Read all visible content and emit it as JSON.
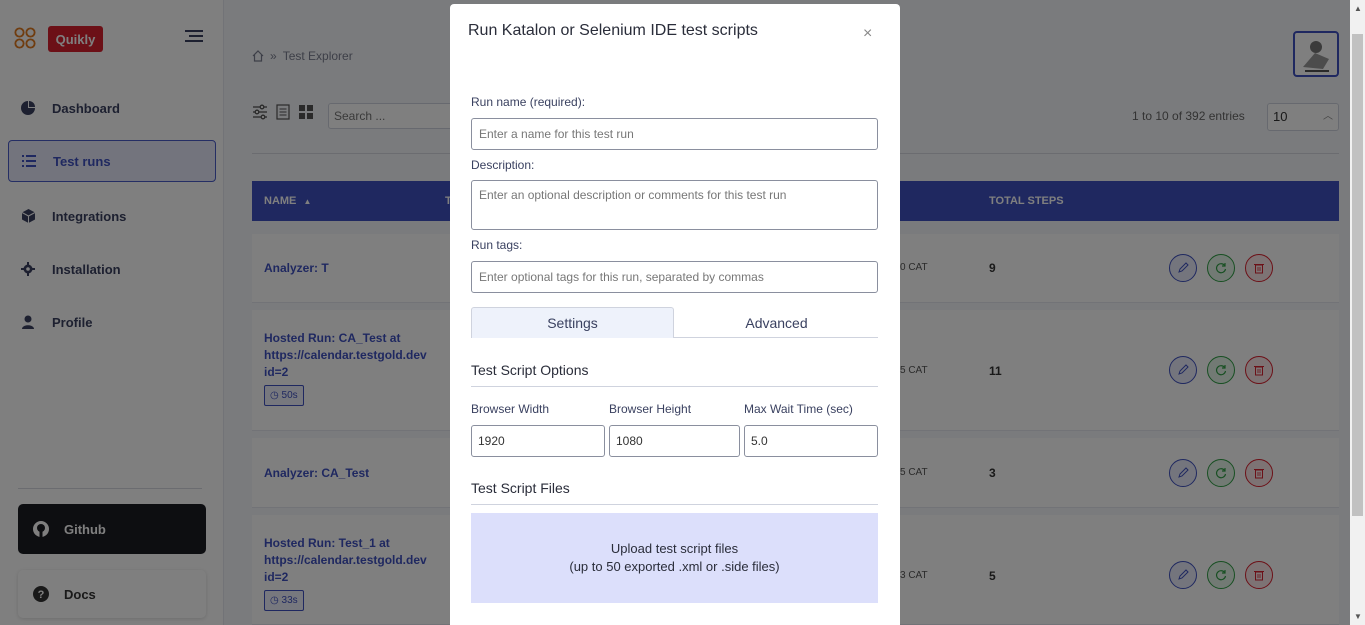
{
  "sidebar": {
    "brand": "Quikly",
    "items": [
      {
        "label": "Dashboard",
        "icon": "pie-chart-icon"
      },
      {
        "label": "Test runs",
        "icon": "list-icon"
      },
      {
        "label": "Integrations",
        "icon": "cube-icon"
      },
      {
        "label": "Installation",
        "icon": "gear-icon"
      },
      {
        "label": "Profile",
        "icon": "user-icon"
      }
    ],
    "github_label": "Github",
    "docs_label": "Docs"
  },
  "breadcrumb": {
    "current": "Test Explorer"
  },
  "toolbar": {
    "search_placeholder": "Search ...",
    "entries_info": "1 to 10 of 392 entries",
    "page_size": "10"
  },
  "table": {
    "headers": {
      "name": "NAME",
      "type": "T",
      "total_steps": "TOTAL STEPS"
    },
    "rows": [
      {
        "name": "Analyzer: T",
        "duration": "",
        "date_suffix": "0 CAT",
        "total_steps": "9"
      },
      {
        "name": "Hosted Run: CA_Test at https://calendar.testgold.dev id=2",
        "duration": "50s",
        "date_suffix": "5 CAT",
        "total_steps": "11"
      },
      {
        "name": "Analyzer: CA_Test",
        "duration": "",
        "date_suffix": "5 CAT",
        "total_steps": "3"
      },
      {
        "name": "Hosted Run: Test_1 at https://calendar.testgold.dev id=2",
        "duration": "33s",
        "date_suffix": "3 CAT",
        "total_steps": "5"
      }
    ]
  },
  "modal": {
    "title": "Run Katalon or Selenium IDE test scripts",
    "run_name_label": "Run name (required):",
    "run_name_placeholder": "Enter a name for this test run",
    "description_label": "Description:",
    "description_placeholder": "Enter an optional description or comments for this test run",
    "tags_label": "Run tags:",
    "tags_placeholder": "Enter optional tags for this run, separated by commas",
    "tabs": [
      "Settings",
      "Advanced"
    ],
    "options_title": "Test Script Options",
    "browser_width_label": "Browser Width",
    "browser_width_value": "1920",
    "browser_height_label": "Browser Height",
    "browser_height_value": "1080",
    "max_wait_label": "Max Wait Time (sec)",
    "max_wait_value": "5.0",
    "files_title": "Test Script Files",
    "upload_line1": "Upload test script files",
    "upload_line2": "(up to 50 exported .xml or .side files)",
    "close_glyph": "×"
  },
  "colors": {
    "primary": "#3f51c1",
    "brand_red": "#d9212f",
    "upload_bg": "#dcdffb"
  }
}
